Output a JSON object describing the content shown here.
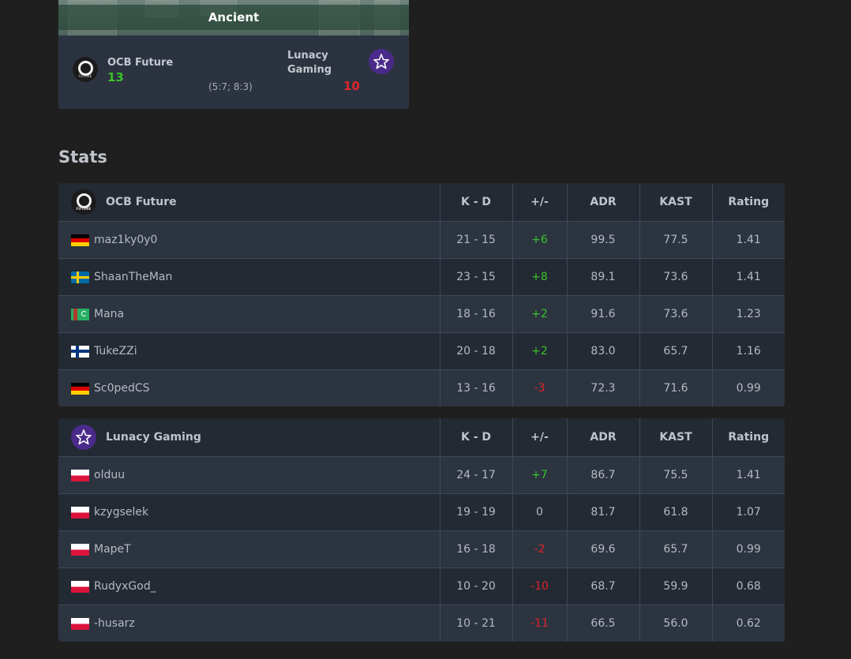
{
  "colors": {
    "background": "#1f1f1f",
    "card": "#2c3340",
    "row_even": "#232a33",
    "row_odd": "#2c3440",
    "positive": "#39c22a",
    "negative": "#e0242a",
    "lunacy_logo": "#4a2a8a"
  },
  "map": {
    "name": "Ancient",
    "team1": {
      "name": "OCB Future",
      "score": "13",
      "logo_icon": "ocb-future-logo-icon",
      "logo_text": "FUTURE"
    },
    "team2": {
      "name": "Lunacy Gaming",
      "score": "10",
      "logo_icon": "lunacy-star-logo-icon"
    },
    "halves": "(5:7; 8:3)"
  },
  "stats": {
    "heading": "Stats",
    "columns": {
      "kd": "K - D",
      "plus_minus": "+/-",
      "adr": "ADR",
      "kast": "KAST",
      "rating": "Rating"
    },
    "teams": [
      {
        "name": "OCB Future",
        "logo_icon": "ocb-future-logo-icon",
        "players": [
          {
            "flag": "de",
            "name": "maz1ky0y0",
            "kd": "21 - 15",
            "pm": "+6",
            "adr": "99.5",
            "kast": "77.5",
            "rating": "1.41"
          },
          {
            "flag": "se",
            "name": "ShaanTheMan",
            "kd": "23 - 15",
            "pm": "+8",
            "adr": "89.1",
            "kast": "73.6",
            "rating": "1.41"
          },
          {
            "flag": "tm",
            "name": "Mana",
            "kd": "18 - 16",
            "pm": "+2",
            "adr": "91.6",
            "kast": "73.6",
            "rating": "1.23"
          },
          {
            "flag": "fi",
            "name": "TukeZZi",
            "kd": "20 - 18",
            "pm": "+2",
            "adr": "83.0",
            "kast": "65.7",
            "rating": "1.16"
          },
          {
            "flag": "de",
            "name": "Sc0pedCS",
            "kd": "13 - 16",
            "pm": "-3",
            "adr": "72.3",
            "kast": "71.6",
            "rating": "0.99"
          }
        ]
      },
      {
        "name": "Lunacy Gaming",
        "logo_icon": "lunacy-star-logo-icon",
        "players": [
          {
            "flag": "pl",
            "name": "olduu",
            "kd": "24 - 17",
            "pm": "+7",
            "adr": "86.7",
            "kast": "75.5",
            "rating": "1.41"
          },
          {
            "flag": "pl",
            "name": "kzygselek",
            "kd": "19 - 19",
            "pm": "0",
            "adr": "81.7",
            "kast": "61.8",
            "rating": "1.07"
          },
          {
            "flag": "pl",
            "name": "MapeT",
            "kd": "16 - 18",
            "pm": "-2",
            "adr": "69.6",
            "kast": "65.7",
            "rating": "0.99"
          },
          {
            "flag": "pl",
            "name": "RudyxGod_",
            "kd": "10 - 20",
            "pm": "-10",
            "adr": "68.7",
            "kast": "59.9",
            "rating": "0.68"
          },
          {
            "flag": "pl",
            "name": "-husarz",
            "kd": "10 - 21",
            "pm": "-11",
            "adr": "66.5",
            "kast": "56.0",
            "rating": "0.62"
          }
        ]
      }
    ]
  }
}
